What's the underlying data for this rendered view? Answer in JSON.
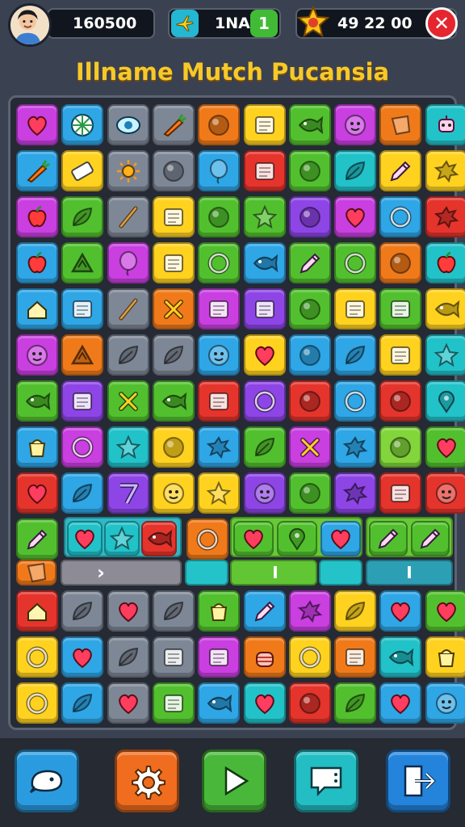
{
  "header": {
    "score": "160500",
    "level_label": "1NA",
    "level_count": "1",
    "coins": "49 22 00"
  },
  "title": "Illname Mutch Pucansia",
  "palette": {
    "pink": "#c93fe0",
    "blue": "#2fa6e6",
    "gray": "#7e8796",
    "orange": "#f07a1a",
    "yellow": "#ffd21f",
    "green": "#52c02e",
    "purple": "#8e45e6",
    "red": "#e5342c",
    "teal": "#22c2c9",
    "lime": "#82d63b"
  },
  "grid": {
    "rows": [
      [
        "pink:heart",
        "blue:ball",
        "gray:eye",
        "gray:carrot",
        "orange:dot",
        "yellow:box",
        "green:fish",
        "pink:face",
        "orange:shape",
        "teal:robot"
      ],
      [
        "blue:carrot",
        "yellow:ticket",
        "gray:sun",
        "gray:dot",
        "blue:balloon",
        "red:box",
        "green:dot",
        "teal:leaf",
        "yellow:pencil",
        "yellow:splat"
      ],
      [
        "pink:apple",
        "green:leaf",
        "gray:stick",
        "yellow:box",
        "green:dot",
        "green:star",
        "purple:dot",
        "pink:heart",
        "blue:ring",
        "red:splat"
      ],
      [
        "blue:apple",
        "green:triangle",
        "pink:balloon",
        "yellow:box",
        "green:ring",
        "blue:fish",
        "green:pencil",
        "green:ring",
        "orange:dot",
        "teal:apple"
      ],
      [
        "blue:house",
        "blue:box",
        "gray:stick",
        "orange:x",
        "pink:box",
        "purple:box",
        "green:dot",
        "yellow:box",
        "green:box",
        "yellow:fish"
      ],
      [
        "pink:face",
        "orange:triangle",
        "gray:leaf",
        "gray:leaf",
        "blue:face",
        "yellow:heart",
        "blue:dot",
        "blue:leaf",
        "yellow:box",
        "teal:star"
      ],
      [
        "green:fish",
        "purple:box",
        "green:x",
        "green:fish",
        "red:box",
        "purple:ring",
        "red:dot",
        "blue:ring",
        "red:dot",
        "teal:pin"
      ],
      [
        "blue:cup",
        "pink:ring",
        "teal:star",
        "yellow:dot",
        "blue:splat",
        "green:leaf",
        "pink:x",
        "blue:splat",
        "lime:dot",
        "green:heart"
      ],
      [
        "red:heart",
        "blue:leaf",
        "purple:seven",
        "yellow:face",
        "yellow:star",
        "purple:face",
        "green:dot",
        "purple:splat",
        "red:box",
        "red:face"
      ]
    ],
    "lower_rows": [
      [
        "red:house",
        "gray:leaf",
        "gray:heart",
        "gray:leaf",
        "green:cup",
        "blue:pencil",
        "pink:splat",
        "yellow:leaf",
        "blue:heart",
        "green:heart"
      ],
      [
        "yellow:ring",
        "blue:heart",
        "gray:leaf",
        "gray:box",
        "pink:box",
        "orange:cake",
        "yellow:ring",
        "orange:box",
        "teal:fish",
        "yellow:cup"
      ],
      [
        "yellow:ring",
        "blue:leaf",
        "gray:heart",
        "green:box",
        "blue:fish",
        "teal:heart",
        "red:dot",
        "green:leaf",
        "blue:heart",
        "blue:face"
      ]
    ]
  },
  "special_row": {
    "left": "green:pencil",
    "bar1": [
      "teal:heart",
      "teal:star",
      "red:fish"
    ],
    "mid": "orange:ring",
    "bar2": [
      "green:heart",
      "green:pin",
      "blue:heart"
    ],
    "bar3": [
      "green:pencil",
      "green:pencil"
    ]
  },
  "progress_row": {
    "left": "orange:shape",
    "arrow": "›",
    "divider_1": "I",
    "divider_2": "I"
  },
  "bottom_buttons": [
    {
      "name": "chat-button",
      "icon": "bubble",
      "color": "#2b9be0"
    },
    {
      "name": "settings-button",
      "icon": "gear",
      "color": "#f06d1f"
    },
    {
      "name": "play-button",
      "icon": "play",
      "color": "#49b83a"
    },
    {
      "name": "message-button",
      "icon": "message",
      "color": "#23bdc4"
    },
    {
      "name": "exit-button",
      "icon": "exit",
      "color": "#2484dc"
    }
  ]
}
